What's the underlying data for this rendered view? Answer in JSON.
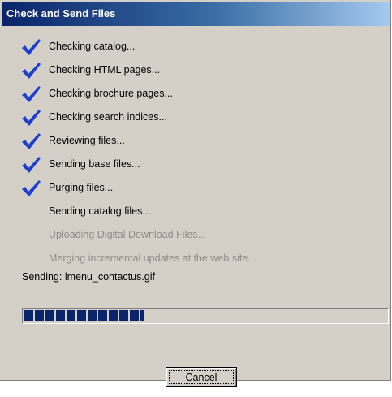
{
  "dialog": {
    "title": "Check and Send Files",
    "title_gradient": [
      "#0a246a",
      "#3a6ea5",
      "#a6caf0"
    ],
    "background": "#d4d0c8"
  },
  "steps": [
    {
      "label": "Checking catalog...",
      "state": "done",
      "icon": "check-icon"
    },
    {
      "label": "Checking HTML pages...",
      "state": "done",
      "icon": "check-icon"
    },
    {
      "label": "Checking brochure pages...",
      "state": "done",
      "icon": "check-icon"
    },
    {
      "label": "Checking search indices...",
      "state": "done",
      "icon": "check-icon"
    },
    {
      "label": "Reviewing files...",
      "state": "done",
      "icon": "check-icon"
    },
    {
      "label": "Sending base files...",
      "state": "done",
      "icon": "check-icon"
    },
    {
      "label": "Purging files...",
      "state": "done",
      "icon": "check-icon"
    },
    {
      "label": "Sending catalog files...",
      "state": "current"
    },
    {
      "label": "Uploading Digital Download Files...",
      "state": "pending"
    },
    {
      "label": "Merging incremental updates at the web site...",
      "state": "pending"
    }
  ],
  "status": {
    "text": "Sending: lmenu_contactus.gif"
  },
  "progress": {
    "fraction": 0.33,
    "fill_color": "#0a246a"
  },
  "buttons": {
    "cancel_label": "Cancel"
  },
  "colors": {
    "check": "#1c3fd0",
    "disabled_text": "#8e8b86"
  }
}
